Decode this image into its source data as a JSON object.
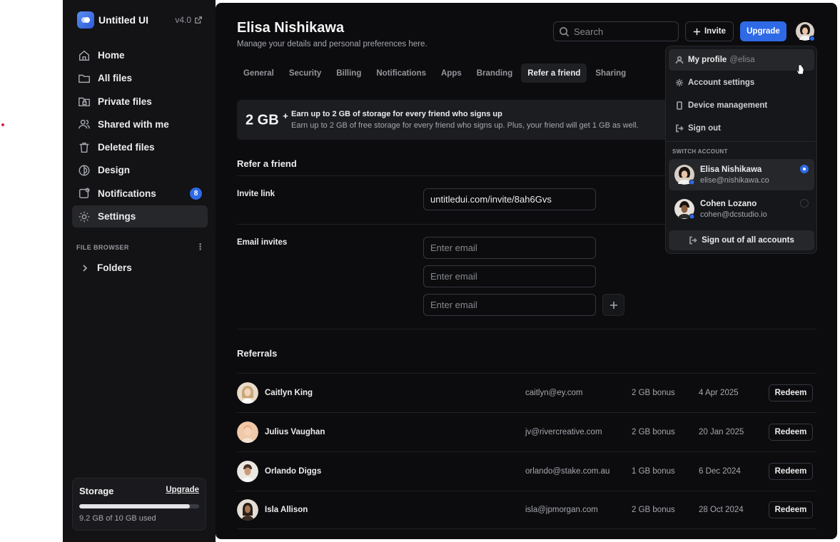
{
  "sidebar": {
    "brand": "Untitled UI",
    "version": "v4.0",
    "items": [
      {
        "label": "Home",
        "icon": "home-icon"
      },
      {
        "label": "All files",
        "icon": "folder-icon"
      },
      {
        "label": "Private files",
        "icon": "lock-folder-icon"
      },
      {
        "label": "Shared with me",
        "icon": "users-icon"
      },
      {
        "label": "Deleted files",
        "icon": "trash-icon"
      },
      {
        "label": "Design",
        "icon": "design-icon"
      },
      {
        "label": "Notifications",
        "icon": "bell-icon",
        "badge": "8"
      },
      {
        "label": "Settings",
        "icon": "gear-icon",
        "active": true
      }
    ],
    "file_browser_label": "FILE BROWSER",
    "folders_label": "Folders",
    "storage": {
      "title": "Storage",
      "upgrade": "Upgrade",
      "used_text": "9.2 GB of 10 GB used",
      "used_fraction": 0.92
    }
  },
  "header": {
    "title": "Elisa Nishikawa",
    "subtitle": "Manage your details and personal preferences here.",
    "search_placeholder": "Search",
    "invite_label": "Invite",
    "upgrade_label": "Upgrade"
  },
  "tabs": [
    "General",
    "Security",
    "Billing",
    "Notifications",
    "Apps",
    "Branding",
    "Refer a friend",
    "Sharing"
  ],
  "active_tab": "Refer a friend",
  "banner": {
    "value": "2 GB",
    "sup": "+",
    "title": "Earn up to 2 GB of storage for every friend who signs up",
    "desc": "Earn up to 2 GB of free storage for every friend who signs up. Plus, your friend will get 1 GB as well."
  },
  "refer": {
    "title": "Refer a friend",
    "invite_link_label": "Invite link",
    "invite_link_value": "untitledui.com/invite/8ah6Gvs",
    "email_invites_label": "Email invites",
    "email_placeholder": "Enter email"
  },
  "referrals": {
    "title": "Referrals",
    "redeem_label": "Redeem",
    "rows": [
      {
        "name": "Caitlyn King",
        "email": "caitlyn@ey.com",
        "bonus": "2 GB bonus",
        "date": "4 Apr 2025"
      },
      {
        "name": "Julius Vaughan",
        "email": "jv@rivercreative.com",
        "bonus": "2 GB bonus",
        "date": "20 Jan 2025"
      },
      {
        "name": "Orlando Diggs",
        "email": "orlando@stake.com.au",
        "bonus": "1 GB bonus",
        "date": "6 Dec 2024"
      },
      {
        "name": "Isla Allison",
        "email": "isla@jpmorgan.com",
        "bonus": "2 GB bonus",
        "date": "28 Oct 2024"
      }
    ]
  },
  "menu": {
    "my_profile": "My profile",
    "handle": "@elisa",
    "account_settings": "Account settings",
    "device_management": "Device management",
    "sign_out": "Sign out",
    "switch_account": "SWITCH ACCOUNT",
    "accounts": [
      {
        "name": "Elisa Nishikawa",
        "email": "elise@nishikawa.co",
        "selected": true
      },
      {
        "name": "Cohen Lozano",
        "email": "cohen@dcstudio.io",
        "selected": false
      }
    ],
    "sign_out_all": "Sign out of all accounts"
  },
  "colors": {
    "accent": "#2e6ae6",
    "sidebar_bg": "#131316",
    "main_bg": "#0c0c0e"
  }
}
